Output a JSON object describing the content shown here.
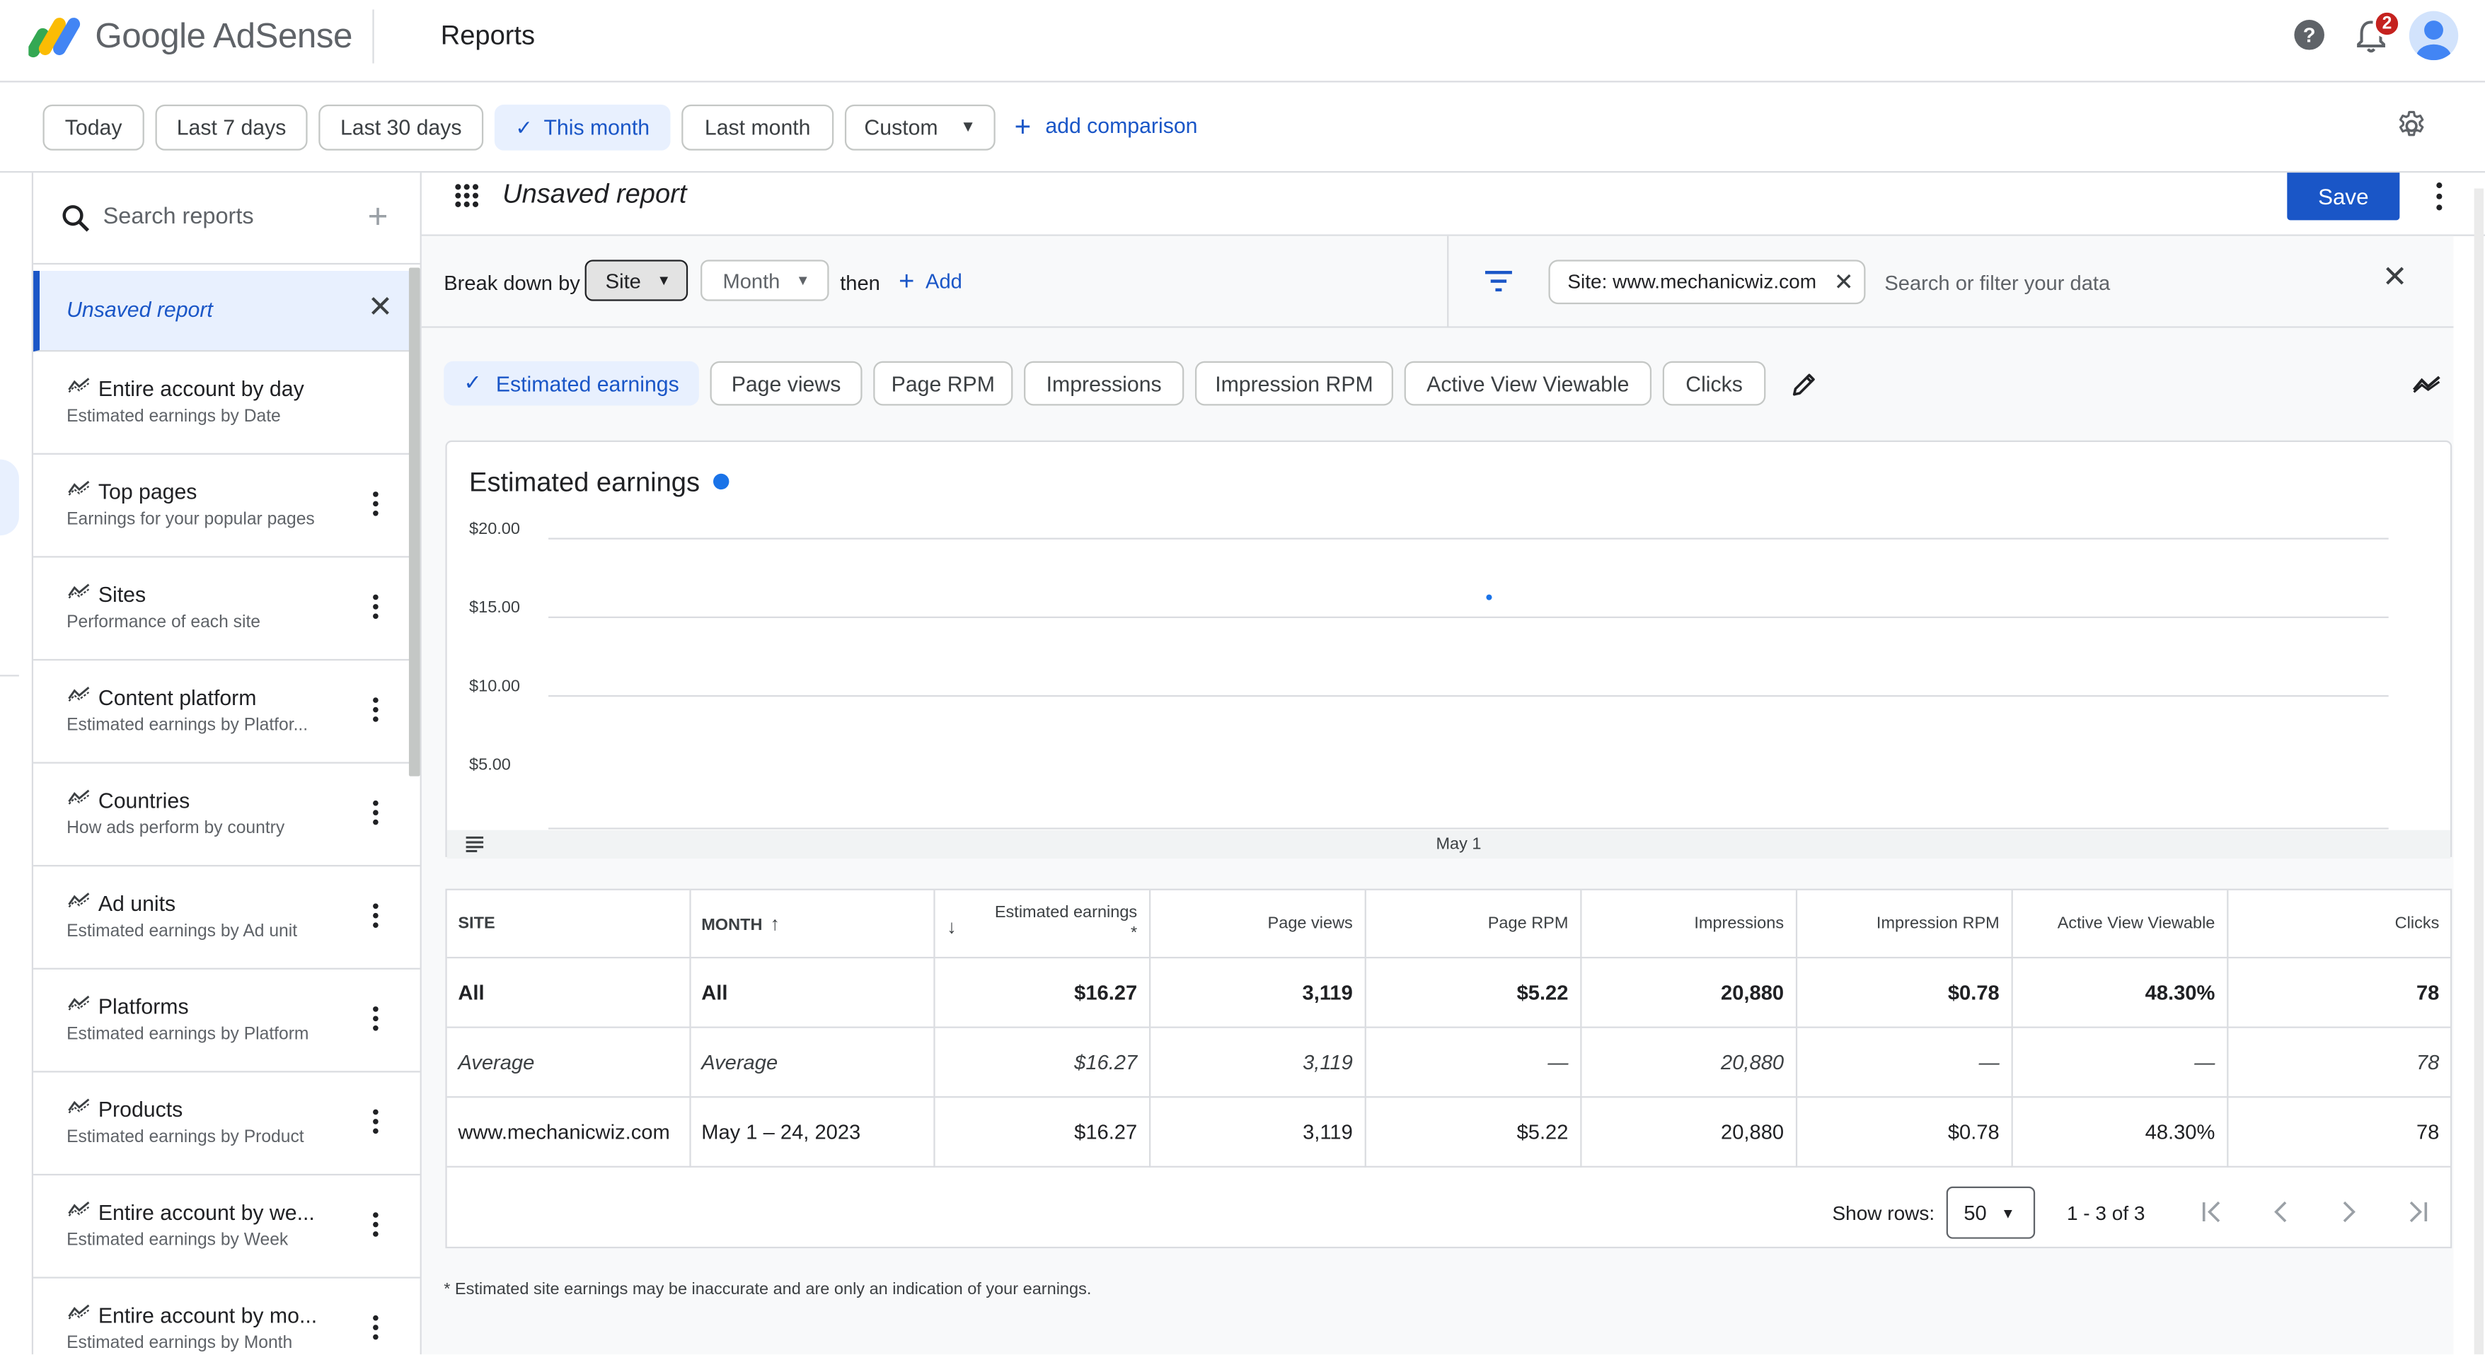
{
  "app": {
    "brand": "Google AdSense",
    "page_title": "Reports",
    "notification_count": "2"
  },
  "date_filters": {
    "today": "Today",
    "last7": "Last 7 days",
    "last30": "Last 30 days",
    "this_month": "This month",
    "last_month": "Last month",
    "custom": "Custom",
    "add_comparison": "add comparison",
    "selected": "This month"
  },
  "sidebar": {
    "search_placeholder": "Search reports",
    "active_item": "Unsaved report",
    "items": [
      {
        "title": "Entire account by day",
        "subtitle": "Estimated earnings by Date"
      },
      {
        "title": "Top pages",
        "subtitle": "Earnings for your popular pages"
      },
      {
        "title": "Sites",
        "subtitle": "Performance of each site"
      },
      {
        "title": "Content platform",
        "subtitle": "Estimated earnings by Platfor..."
      },
      {
        "title": "Countries",
        "subtitle": "How ads perform by country"
      },
      {
        "title": "Ad units",
        "subtitle": "Estimated earnings by Ad unit"
      },
      {
        "title": "Platforms",
        "subtitle": "Estimated earnings by Platform"
      },
      {
        "title": "Products",
        "subtitle": "Estimated earnings by Product"
      },
      {
        "title": "Entire account by we...",
        "subtitle": "Estimated earnings by Week"
      },
      {
        "title": "Entire account by mo...",
        "subtitle": "Estimated earnings by Month"
      }
    ]
  },
  "report": {
    "name": "Unsaved report",
    "save_label": "Save",
    "breakdown_label": "Break down by",
    "breakdown_primary": "Site",
    "breakdown_secondary": "Month",
    "then_label": "then",
    "add_label": "Add",
    "filter_chip": "Site: www.mechanicwiz.com",
    "filter_placeholder": "Search or filter your data"
  },
  "metrics": {
    "estimated_earnings": "Estimated earnings",
    "page_views": "Page views",
    "page_rpm": "Page RPM",
    "impressions": "Impressions",
    "impression_rpm": "Impression RPM",
    "active_view": "Active View Viewable",
    "clicks": "Clicks",
    "selected": "Estimated earnings"
  },
  "chart_data": {
    "type": "scatter",
    "title": "Estimated earnings",
    "xlabel": "",
    "ylabel": "",
    "x": [
      "May 1"
    ],
    "series": [
      {
        "name": "Estimated earnings",
        "values": [
          16.27
        ],
        "color": "#1a73e8"
      }
    ],
    "y_ticks": [
      "$20.00",
      "$15.00",
      "$10.00",
      "$5.00"
    ],
    "y_tick_values": [
      20,
      15,
      10,
      5
    ],
    "ylim": [
      0,
      20
    ],
    "grid": true,
    "x_tick_label": "May 1"
  },
  "table": {
    "headers": {
      "site": "SITE",
      "month": "MONTH",
      "estimated_earnings": "Estimated earnings",
      "estimated_marker": "*",
      "page_views": "Page views",
      "page_rpm": "Page RPM",
      "impressions": "Impressions",
      "impression_rpm": "Impression RPM",
      "active_view": "Active View Viewable",
      "clicks": "Clicks"
    },
    "rows": [
      {
        "site": "All",
        "month": "All",
        "earnings": "$16.27",
        "page_views": "3,119",
        "page_rpm": "$5.22",
        "impressions": "20,880",
        "impression_rpm": "$0.78",
        "active_view": "48.30%",
        "clicks": "78"
      },
      {
        "site": "Average",
        "month": "Average",
        "earnings": "$16.27",
        "page_views": "3,119",
        "page_rpm": "—",
        "impressions": "20,880",
        "impression_rpm": "—",
        "active_view": "—",
        "clicks": "78"
      },
      {
        "site": "www.mechanicwiz.com",
        "month": "May 1 – 24, 2023",
        "earnings": "$16.27",
        "page_views": "3,119",
        "page_rpm": "$5.22",
        "impressions": "20,880",
        "impression_rpm": "$0.78",
        "active_view": "48.30%",
        "clicks": "78"
      }
    ],
    "show_rows_label": "Show rows:",
    "rows_per_page": "50",
    "range": "1 - 3 of 3"
  },
  "footnote": "* Estimated site earnings may be inaccurate and are only an indication of your earnings.",
  "colors": {
    "accent": "#1a56c7",
    "series": "#1a73e8",
    "badge": "#c5221f"
  }
}
